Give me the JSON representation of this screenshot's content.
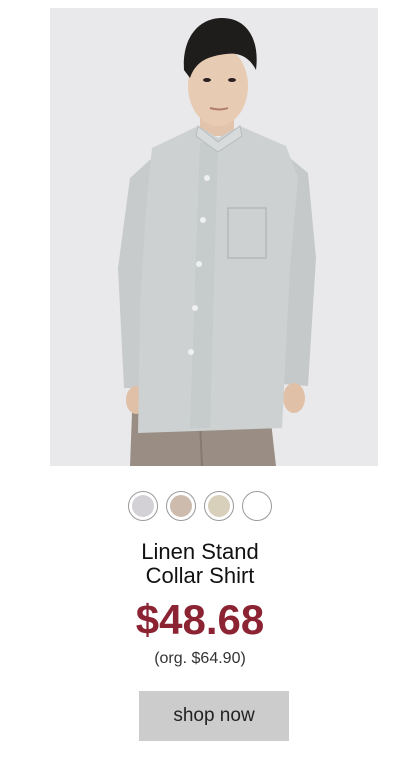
{
  "product": {
    "name_line1": "Linen Stand",
    "name_line2": "Collar Shirt",
    "price": "$48.68",
    "original_price": "(org. $64.90)",
    "cta_label": "shop now",
    "swatches": [
      {
        "color": "#d3d1d6"
      },
      {
        "color": "#cdbcae"
      },
      {
        "color": "#d8d0bb"
      },
      {
        "color": "#ffffff"
      }
    ]
  },
  "colors": {
    "price": "#8b2332",
    "button_bg": "#cccccc",
    "image_bg": "#e9e9eb"
  }
}
